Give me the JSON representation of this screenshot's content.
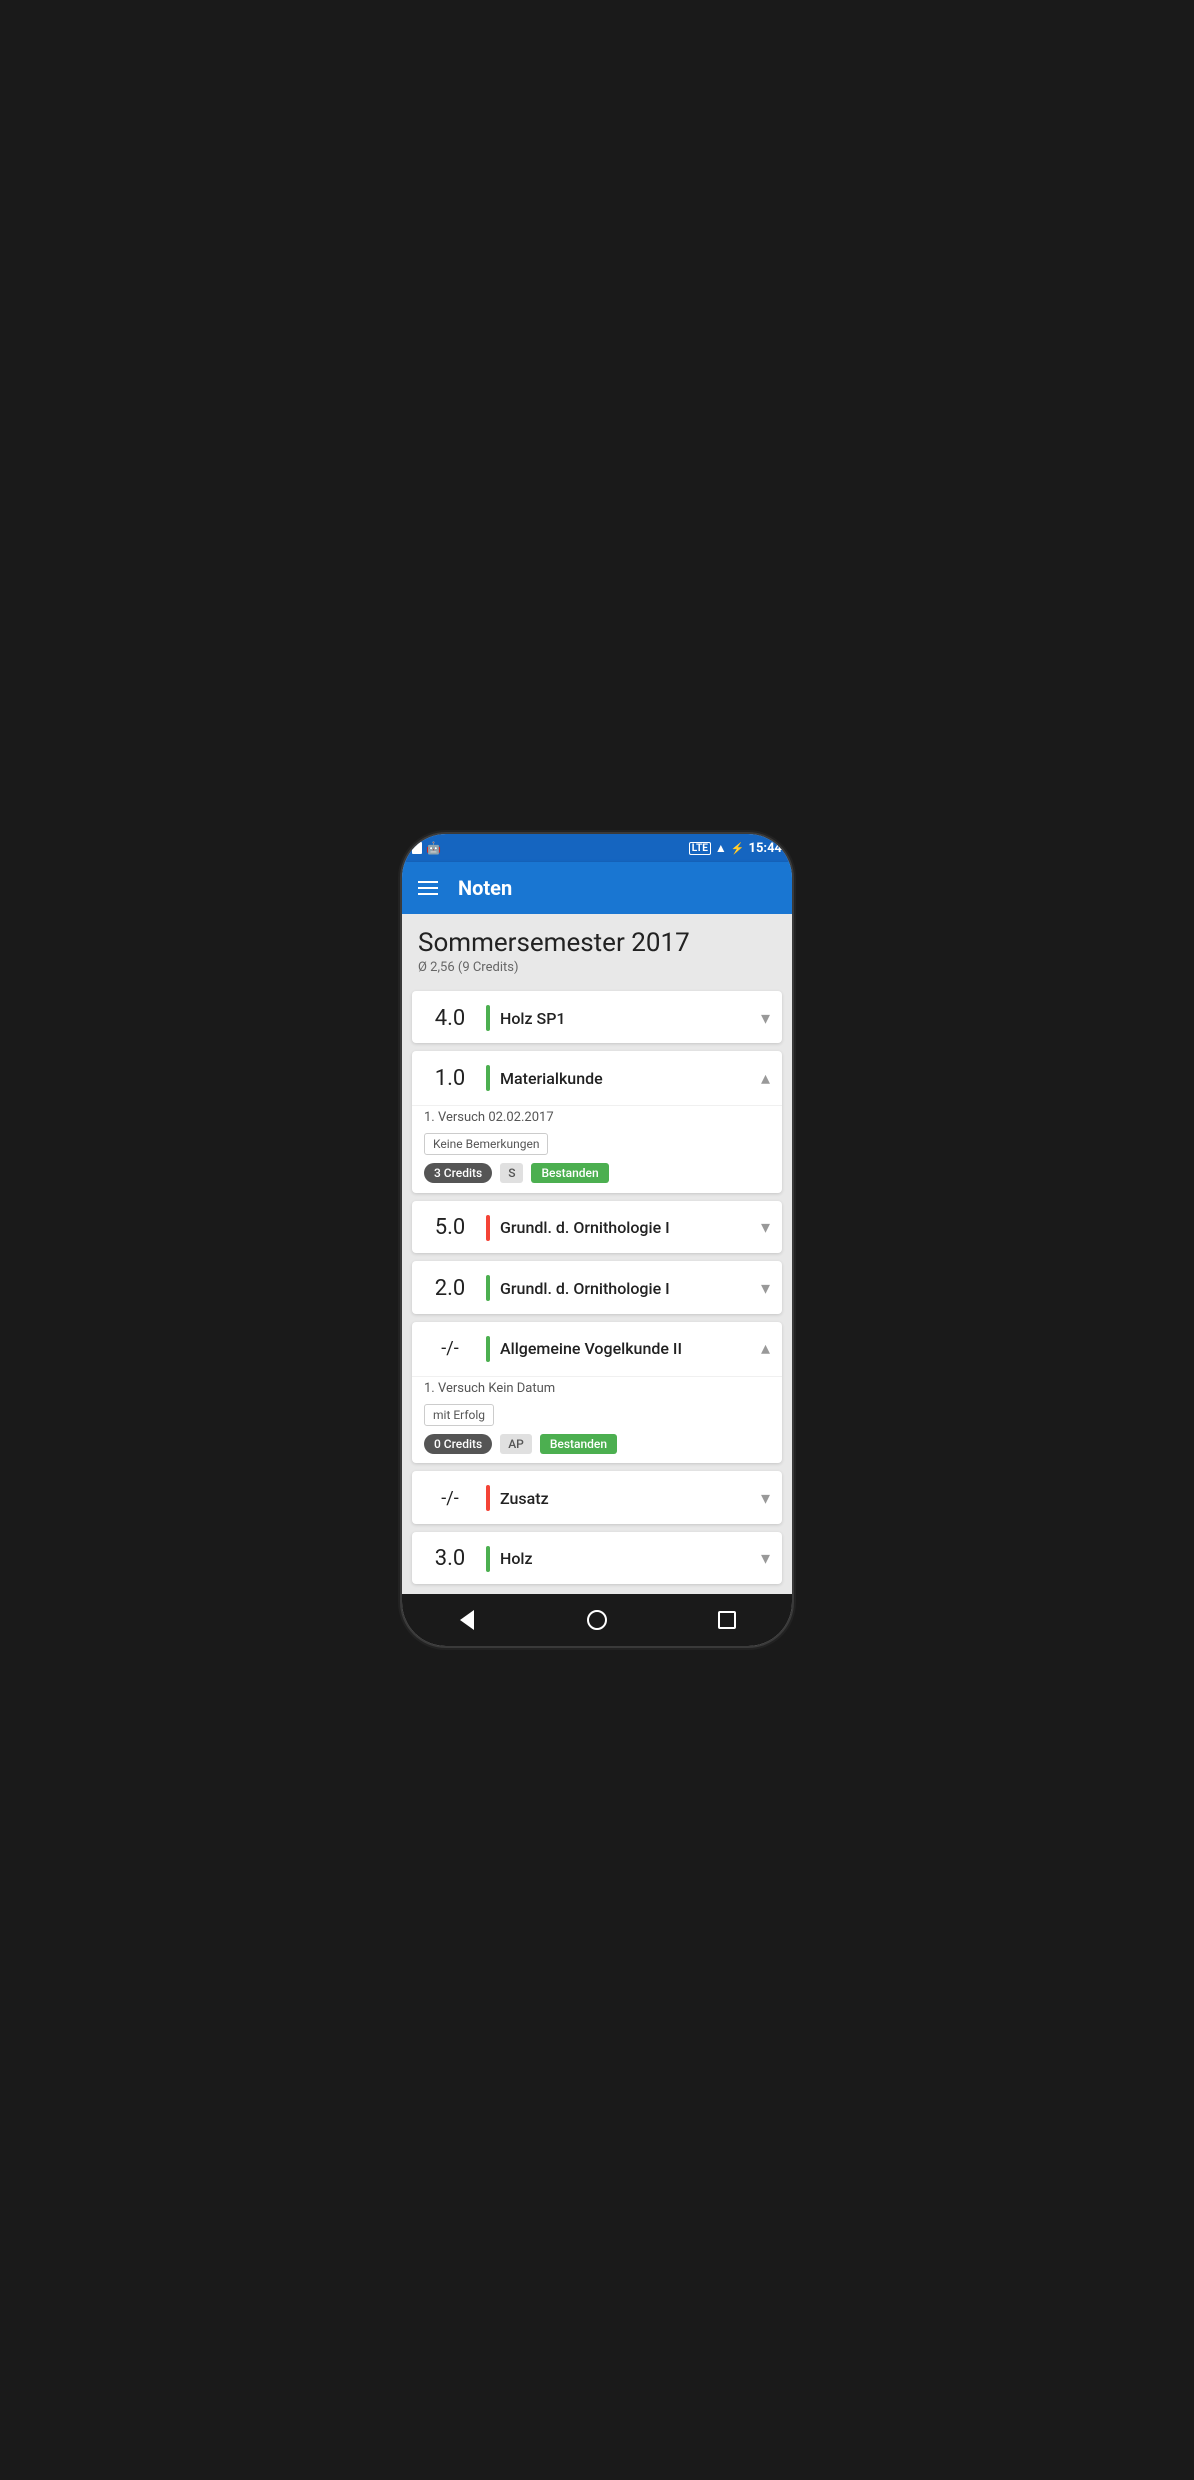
{
  "status_bar": {
    "time": "15:44",
    "signal": "LTE"
  },
  "app_bar": {
    "title": "Noten"
  },
  "semester": {
    "title": "Sommersemester 2017",
    "subtitle": "Ø 2,56 (9 Credits)"
  },
  "grades": [
    {
      "id": "holz-sp1",
      "value": "4.0",
      "bar_color": "green",
      "name": "Holz SP1",
      "expanded": false,
      "chevron": "▾"
    },
    {
      "id": "materialkunde",
      "value": "1.0",
      "bar_color": "green",
      "name": "Materialkunde",
      "expanded": true,
      "chevron": "▴",
      "attempt": "1. Versuch  02.02.2017",
      "remark": "Keine Bemerkungen",
      "credits": "3 Credits",
      "type": "S",
      "status": "Bestanden"
    },
    {
      "id": "grundl-ornithologie-5",
      "value": "5.0",
      "bar_color": "red",
      "name": "Grundl. d. Ornithologie I",
      "expanded": false,
      "chevron": "▾"
    },
    {
      "id": "grundl-ornithologie-2",
      "value": "2.0",
      "bar_color": "green",
      "name": "Grundl. d. Ornithologie I",
      "expanded": false,
      "chevron": "▾"
    },
    {
      "id": "allgemeine-vogelkunde",
      "value": "-/-",
      "bar_color": "green",
      "name": "Allgemeine Vogelkunde II",
      "expanded": true,
      "chevron": "▴",
      "attempt": "1. Versuch  Kein Datum",
      "remark": "mit Erfolg",
      "credits": "0 Credits",
      "type": "AP",
      "status": "Bestanden"
    },
    {
      "id": "zusatz",
      "value": "-/-",
      "bar_color": "red",
      "name": "Zusatz",
      "expanded": false,
      "chevron": "▾"
    },
    {
      "id": "holz",
      "value": "3.0",
      "bar_color": "green",
      "name": "Holz",
      "expanded": false,
      "chevron": "▾"
    }
  ],
  "bottom_nav": {
    "back_label": "back",
    "home_label": "home",
    "recents_label": "recents"
  }
}
